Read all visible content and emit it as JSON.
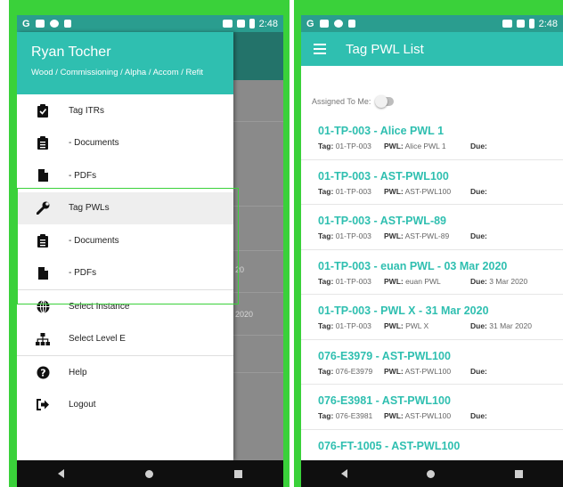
{
  "status_bar": {
    "time": "2:48",
    "left_glyphs": [
      "G"
    ]
  },
  "left_screen": {
    "drawer": {
      "user_name": "Ryan Tocher",
      "path": "Wood / Commissioning / Alpha / Accom / Refit",
      "items": [
        {
          "label": "Tag ITRs",
          "icon": "clipboard-check-icon"
        },
        {
          "label": "- Documents",
          "icon": "clipboard-list-icon"
        },
        {
          "label": "- PDFs",
          "icon": "file-icon"
        },
        {
          "label": "Tag PWLs",
          "icon": "wrench-icon"
        },
        {
          "label": "- Documents",
          "icon": "clipboard-list-icon"
        },
        {
          "label": "- PDFs",
          "icon": "file-icon"
        },
        {
          "label": "Select Instance",
          "icon": "globe-icon"
        },
        {
          "label": "Select Level E",
          "icon": "sitemap-icon"
        },
        {
          "label": "Help",
          "icon": "question-circle-icon"
        },
        {
          "label": "Logout",
          "icon": "sign-out-icon"
        }
      ]
    },
    "background_fragments": [
      "20",
      "2020"
    ]
  },
  "right_screen": {
    "title": "Tag PWL List",
    "assigned_to_me_label": "Assigned To Me:",
    "labels": {
      "tag": "Tag:",
      "pwl": "PWL:",
      "due": "Due:"
    },
    "items": [
      {
        "title": "01-TP-003 - Alice PWL 1",
        "tag": "01-TP-003",
        "pwl": "Alice PWL 1",
        "due": ""
      },
      {
        "title": "01-TP-003 - AST-PWL100",
        "tag": "01-TP-003",
        "pwl": "AST-PWL100",
        "due": ""
      },
      {
        "title": "01-TP-003 - AST-PWL-89",
        "tag": "01-TP-003",
        "pwl": "AST-PWL-89",
        "due": ""
      },
      {
        "title": "01-TP-003 - euan PWL - 03 Mar 2020",
        "tag": "01-TP-003",
        "pwl": "euan PWL",
        "due": "3 Mar 2020"
      },
      {
        "title": "01-TP-003 - PWL X - 31 Mar 2020",
        "tag": "01-TP-003",
        "pwl": "PWL X",
        "due": "31 Mar 2020"
      },
      {
        "title": "076-E3979 - AST-PWL100",
        "tag": "076-E3979",
        "pwl": "AST-PWL100",
        "due": ""
      },
      {
        "title": "076-E3981 - AST-PWL100",
        "tag": "076-E3981",
        "pwl": "AST-PWL100",
        "due": ""
      },
      {
        "title": "076-FT-1005 - AST-PWL100",
        "tag": "",
        "pwl": "",
        "due": ""
      }
    ]
  },
  "colors": {
    "accent": "#2fbfb0",
    "status_bar": "#2a9d8f",
    "highlight": "#3ad13a",
    "nav_bar": "#0f0f0f"
  }
}
